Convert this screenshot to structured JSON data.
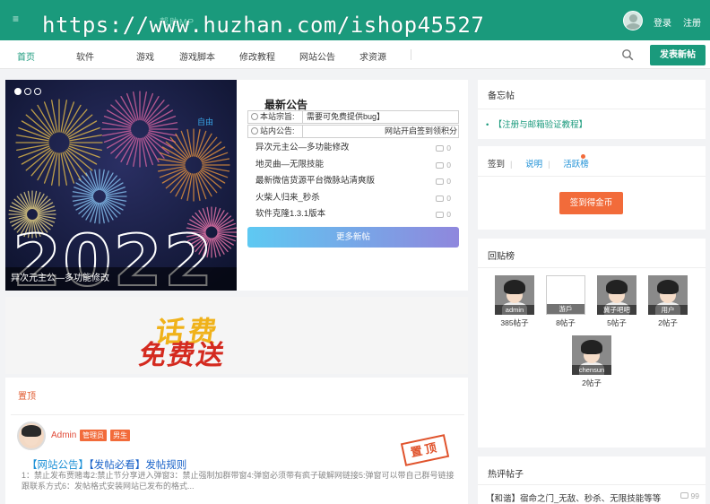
{
  "topbar": {
    "logo": "帮助MP",
    "watermark": "https://www.huzhan.com/ishop45527",
    "login": "登录",
    "register": "注册"
  },
  "nav": {
    "items": [
      "首页",
      "软件",
      "游戏",
      "游戏脚本",
      "修改教程",
      "网站公告",
      "求资源"
    ],
    "post_button": "发表新帖"
  },
  "carousel": {
    "caption": "异次元主公—多功能修改",
    "year_art": "2022",
    "corner_tag": "自由"
  },
  "announcements": {
    "title": "最新公告",
    "notices": [
      {
        "label": "本站宗旨:",
        "value": "需要可免费提供bug】"
      },
      {
        "label": "站内公告:",
        "value": "网站开启签到领积分"
      }
    ],
    "items": [
      {
        "title": "异次元主公—多功能修改",
        "count": "0"
      },
      {
        "title": "地灵曲—无限技能",
        "count": "0"
      },
      {
        "title": "最新微信货源平台微脉站清爽版",
        "count": "0"
      },
      {
        "title": "火柴人归来_秒杀",
        "count": "0"
      },
      {
        "title": "软件克隆1.3.1版本",
        "count": "0"
      }
    ],
    "more_button": "更多新帖"
  },
  "banner": {
    "line1": "话费",
    "line2": "免费送"
  },
  "sticky": {
    "heading": "置顶",
    "post": {
      "author": "Admin",
      "badges": [
        "管理员",
        "男生"
      ],
      "category": "【网站公告】",
      "title": "【发帖必看】发帖规则",
      "excerpt": "1：禁止发布贾赌毒2:禁止节分享进入弹窗3：禁止强制加群带窗4:弹窗必须带有疯子破解网链接5:弹窗可以带自己群号链接跟联系方式6：发帖格式安装网站已发布的格式...",
      "stamp": "置顶"
    }
  },
  "sidebar": {
    "memo_title": "备忘帖",
    "memo_link": "【注册与邮箱验证教程】",
    "signin_tabs": [
      "签到",
      "说明",
      "活跃榜"
    ],
    "signin_button": "签到得金币",
    "reply_title": "回贴榜",
    "reply_users": [
      {
        "name": "admin",
        "count": "385帖子"
      },
      {
        "name": "游戶",
        "count": "8帖子"
      },
      {
        "name": "冀子吧吧",
        "count": "5帖子"
      },
      {
        "name": "用户",
        "count": "2帖子"
      },
      {
        "name": "chensun",
        "count": "2帖子"
      }
    ],
    "hot_title": "热评帖子",
    "hot_item": {
      "title": "【和谐】宿命之门_无敌、秒杀、无限技能等等",
      "count": "99"
    }
  },
  "colors": {
    "brand": "#1a9a7c",
    "accent": "#f26b3a",
    "link": "#1b63c9"
  }
}
